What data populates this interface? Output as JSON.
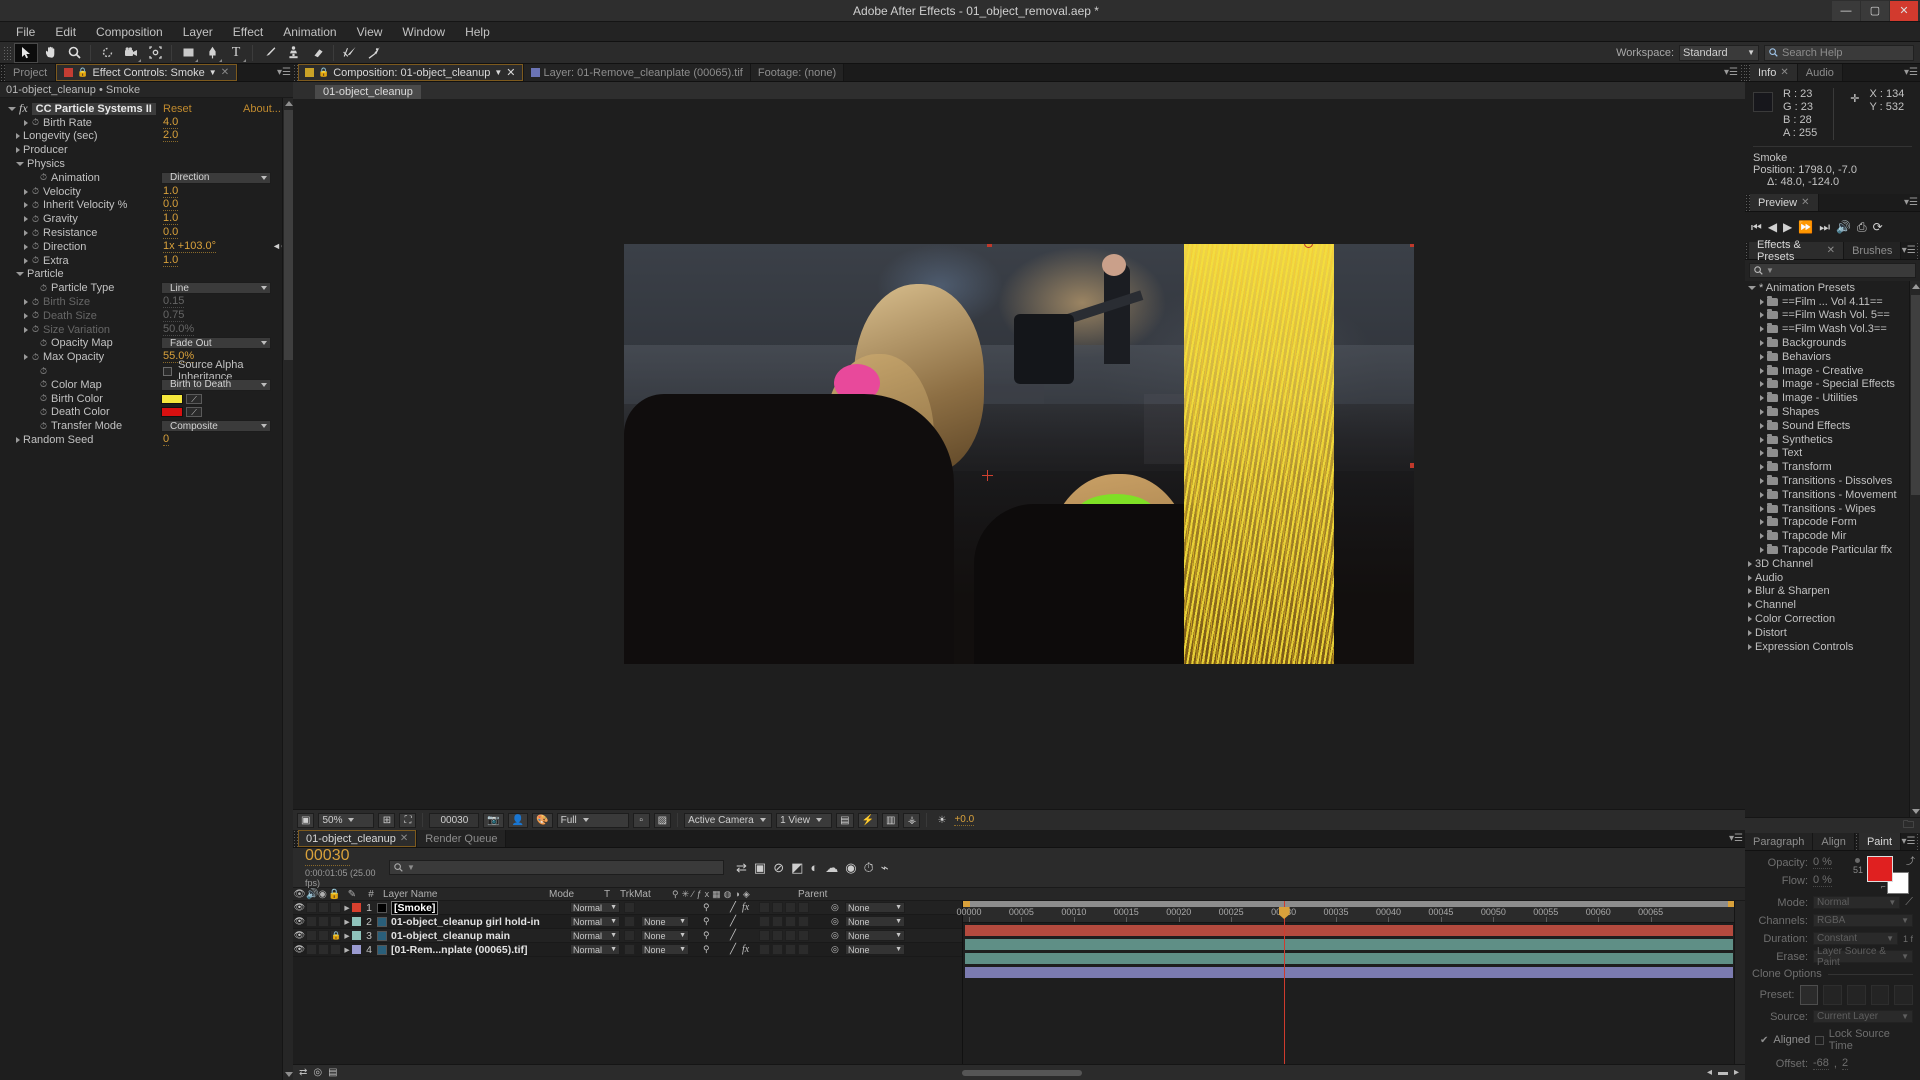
{
  "window": {
    "title": "Adobe After Effects - 01_object_removal.aep *",
    "minimize": "—",
    "maximize": "▢",
    "close": "✕"
  },
  "menu": [
    "File",
    "Edit",
    "Composition",
    "Layer",
    "Effect",
    "Animation",
    "View",
    "Window",
    "Help"
  ],
  "toolbar": {
    "workspace_label": "Workspace:",
    "workspace_value": "Standard",
    "search_placeholder": "Search Help",
    "tools": [
      {
        "name": "selection-tool",
        "glyph": "➤"
      },
      {
        "name": "hand-tool",
        "glyph": "✋"
      },
      {
        "name": "zoom-tool",
        "glyph": "🔍"
      },
      {
        "name": "rotation-tool",
        "glyph": "◯"
      },
      {
        "name": "camera-tool",
        "glyph": "🎥"
      },
      {
        "name": "pan-behind-tool",
        "glyph": "⛶"
      },
      {
        "name": "shape-tool",
        "glyph": "▭"
      },
      {
        "name": "pen-tool",
        "glyph": "✒"
      },
      {
        "name": "type-tool",
        "glyph": "T"
      },
      {
        "name": "brush-tool",
        "glyph": "／"
      },
      {
        "name": "clone-stamp-tool",
        "glyph": "⚲"
      },
      {
        "name": "eraser-tool",
        "glyph": "▰"
      },
      {
        "name": "roto-brush-tool",
        "glyph": "✎"
      },
      {
        "name": "puppet-pin-tool",
        "glyph": "📌"
      }
    ]
  },
  "effect_controls": {
    "tab_label": "Effect Controls: Smoke",
    "project_tab": "Project",
    "header": "01-object_cleanup • Smoke",
    "effect_name": "CC Particle Systems II",
    "reset": "Reset",
    "about": "About...",
    "rows": [
      {
        "label": "Birth Rate",
        "value": "4.0",
        "indent": 2,
        "tri": true,
        "stopwatch": true
      },
      {
        "label": "Longevity (sec)",
        "value": "2.0",
        "indent": 1,
        "tri": true,
        "stopwatch": false
      },
      {
        "label": "Producer",
        "value": "",
        "indent": 1,
        "tri": true,
        "stopwatch": false,
        "group": true
      },
      {
        "label": "Physics",
        "value": "",
        "indent": 1,
        "tri": "open",
        "stopwatch": false,
        "group": true
      },
      {
        "label": "Animation",
        "combo": "Direction",
        "indent": 3,
        "stopwatch": true
      },
      {
        "label": "Velocity",
        "value": "1.0",
        "indent": 2,
        "tri": true,
        "stopwatch": true
      },
      {
        "label": "Inherit Velocity %",
        "value": "0.0",
        "indent": 2,
        "tri": true,
        "stopwatch": true
      },
      {
        "label": "Gravity",
        "value": "1.0",
        "indent": 2,
        "tri": true,
        "stopwatch": true
      },
      {
        "label": "Resistance",
        "value": "0.0",
        "indent": 2,
        "tri": true,
        "stopwatch": true
      },
      {
        "label": "Direction",
        "value": "1x +103.0°",
        "indent": 2,
        "tri": true,
        "stopwatch": true,
        "dial": true
      },
      {
        "label": "Extra",
        "value": "1.0",
        "indent": 2,
        "tri": true,
        "stopwatch": true
      },
      {
        "label": "Particle",
        "value": "",
        "indent": 1,
        "tri": "open",
        "stopwatch": false,
        "group": true
      },
      {
        "label": "Particle Type",
        "combo": "Line",
        "indent": 3,
        "stopwatch": true
      },
      {
        "label": "Birth Size",
        "value": "0.15",
        "indent": 2,
        "tri": true,
        "stopwatch": true,
        "disabled": true
      },
      {
        "label": "Death Size",
        "value": "0.75",
        "indent": 2,
        "tri": true,
        "stopwatch": true,
        "disabled": true
      },
      {
        "label": "Size Variation",
        "value": "50.0%",
        "indent": 2,
        "tri": true,
        "stopwatch": true,
        "disabled": true
      },
      {
        "label": "Opacity Map",
        "combo": "Fade Out",
        "indent": 3,
        "stopwatch": true
      },
      {
        "label": "Max Opacity",
        "value": "55.0%",
        "indent": 2,
        "tri": true,
        "stopwatch": true
      },
      {
        "label": "",
        "checkbox": "Source Alpha Inheritance",
        "indent": 3,
        "stopwatch": true
      },
      {
        "label": "Color Map",
        "combo": "Birth to Death",
        "indent": 3,
        "stopwatch": true
      },
      {
        "label": "Birth Color",
        "swatch": "#f5e83c",
        "indent": 3,
        "stopwatch": true
      },
      {
        "label": "Death Color",
        "swatch": "#d81010",
        "indent": 3,
        "stopwatch": true
      },
      {
        "label": "Transfer Mode",
        "combo": "Composite",
        "indent": 3,
        "stopwatch": true
      },
      {
        "label": "Random Seed",
        "value": "0",
        "indent": 1,
        "tri": true,
        "stopwatch": false
      }
    ]
  },
  "viewer": {
    "tabs": [
      {
        "label": "Composition: 01-object_cleanup",
        "active": true,
        "closable": true
      },
      {
        "label": "Layer: 01-Remove_cleanplate  (00065).tif",
        "active": false
      },
      {
        "label": "Footage: (none)",
        "active": false
      }
    ],
    "subtab": "01-object_cleanup",
    "bar": {
      "zoom": "50%",
      "time": "00030",
      "resolution": "Full",
      "camera": "Active Camera",
      "views": "1 View",
      "exposure": "+0.0"
    }
  },
  "timeline": {
    "tabs": [
      {
        "label": "01-object_cleanup",
        "active": true
      },
      {
        "label": "Render Queue",
        "active": false
      }
    ],
    "current_time": "00030",
    "current_time_sub": "0:00:01:05 (25.00 fps)",
    "search_placeholder": "",
    "columns": [
      "Layer Name",
      "Mode",
      "T",
      "TrkMat",
      "Parent"
    ],
    "col_hash": "#",
    "ruler_labels": [
      "00000",
      "00005",
      "00010",
      "00015",
      "00020",
      "00025",
      "00030",
      "00035",
      "00040",
      "00045",
      "00050",
      "00055",
      "00060",
      "00065"
    ],
    "layers": [
      {
        "num": "1",
        "name": "[Smoke]",
        "editing": true,
        "color": "#d8402e",
        "mode": "Normal",
        "trkmat": "",
        "parent": "None",
        "locked": false,
        "fx": true,
        "bar": "#b44a3e"
      },
      {
        "num": "2",
        "name": "01-object_cleanup girl hold-in",
        "editing": false,
        "color": "#8fc3bb",
        "mode": "Normal",
        "trkmat": "None",
        "parent": "None",
        "locked": false,
        "fx": false,
        "bar": "#5f8f86"
      },
      {
        "num": "3",
        "name": "01-object_cleanup main",
        "editing": false,
        "color": "#8fc3bb",
        "mode": "Normal",
        "trkmat": "None",
        "parent": "None",
        "locked": true,
        "fx": false,
        "bar": "#5f8f86"
      },
      {
        "num": "4",
        "name": "[01-Rem...nplate  (00065).tif]",
        "editing": false,
        "color": "#9a9ad0",
        "mode": "Normal",
        "trkmat": "None",
        "parent": "None",
        "locked": false,
        "fx": true,
        "bar": "#7b7bb0"
      }
    ]
  },
  "info": {
    "tabs": [
      {
        "label": "Info",
        "active": true
      },
      {
        "label": "Audio",
        "active": false
      }
    ],
    "r": "R : 23",
    "g": "G : 23",
    "b": "B : 28",
    "a": "A : 255",
    "x": "X : 134",
    "y": "Y : 532",
    "layer": "Smoke",
    "position": "Position: 1798.0, -7.0",
    "delta": "Δ: 48.0, -124.0",
    "swatch": "#17171c"
  },
  "preview": {
    "tab": "Preview",
    "buttons": [
      "⏮",
      "◀",
      "▶",
      "⏩",
      "⏭",
      "🔊",
      "⎙",
      "⟳"
    ]
  },
  "effects_presets": {
    "tabs": [
      {
        "label": "Effects & Presets",
        "active": true
      },
      {
        "label": "Brushes",
        "active": false
      }
    ],
    "search_placeholder": "",
    "root": "* Animation Presets",
    "folders": [
      "==Film ... Vol 4.11==",
      "==Film Wash Vol. 5==",
      "==Film Wash Vol.3==",
      "Backgrounds",
      "Behaviors",
      "Image - Creative",
      "Image - Special Effects",
      "Image - Utilities",
      "Shapes",
      "Sound Effects",
      "Synthetics",
      "Text",
      "Transform",
      "Transitions - Dissolves",
      "Transitions - Movement",
      "Transitions - Wipes",
      "Trapcode Form",
      "Trapcode Mir",
      "Trapcode Particular ffx"
    ],
    "categories": [
      "3D Channel",
      "Audio",
      "Blur & Sharpen",
      "Channel",
      "Color Correction",
      "Distort",
      "Expression Controls"
    ]
  },
  "paint": {
    "tabs": [
      {
        "label": "Paragraph",
        "active": false
      },
      {
        "label": "Align",
        "active": false
      },
      {
        "label": "Paint",
        "active": true
      }
    ],
    "opacity_label": "Opacity:",
    "opacity_value": "0 %",
    "flow_label": "Flow:",
    "flow_value": "0 %",
    "brush_size": "51",
    "mode_label": "Mode:",
    "mode_value": "Normal",
    "channels_label": "Channels:",
    "channels_value": "RGBA",
    "duration_label": "Duration:",
    "duration_value": "Constant",
    "duration_frames": "1 f",
    "erase_label": "Erase:",
    "erase_value": "Layer Source & Paint",
    "clone_options": "Clone Options",
    "preset_label": "Preset:",
    "source_label": "Source:",
    "source_value": "Current Layer",
    "aligned": "Aligned",
    "lock_source_time": "Lock Source Time",
    "offset_label": "Offset:",
    "offset_x": "-68",
    "offset_y": "2",
    "fg_color": "#e02020",
    "bg_color": "#ffffff"
  }
}
